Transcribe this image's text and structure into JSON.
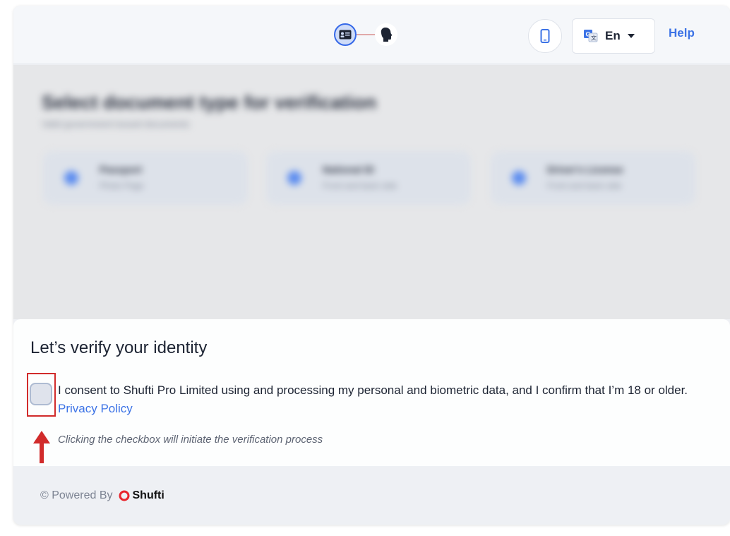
{
  "header": {
    "language": "En",
    "help_label": "Help"
  },
  "background": {
    "title": "Select document type for verification",
    "subtitle": "Valid government-issued documents",
    "documents": [
      {
        "name": "Passport",
        "desc": "Photo Page"
      },
      {
        "name": "National ID",
        "desc": "Front and back side"
      },
      {
        "name": "Driver's License",
        "desc": "Front and back side"
      }
    ]
  },
  "consent": {
    "title": "Let’s verify your identity",
    "text": "I consent to Shufti Pro Limited using and processing my personal and biometric data, and I confirm that I’m 18 or older.",
    "privacy_label": "Privacy Policy",
    "hint": "Clicking the checkbox will initiate the verification process",
    "checked": false
  },
  "footer": {
    "powered_by": "© Powered By",
    "brand": "Shufti"
  },
  "colors": {
    "accent": "#3c73e6",
    "highlight": "#d12b2b"
  },
  "icons": [
    "id-card-icon",
    "face-icon",
    "mobile-icon",
    "translate-icon",
    "caret-down-icon",
    "red-arrow-icon",
    "shufti-logo-icon"
  ]
}
